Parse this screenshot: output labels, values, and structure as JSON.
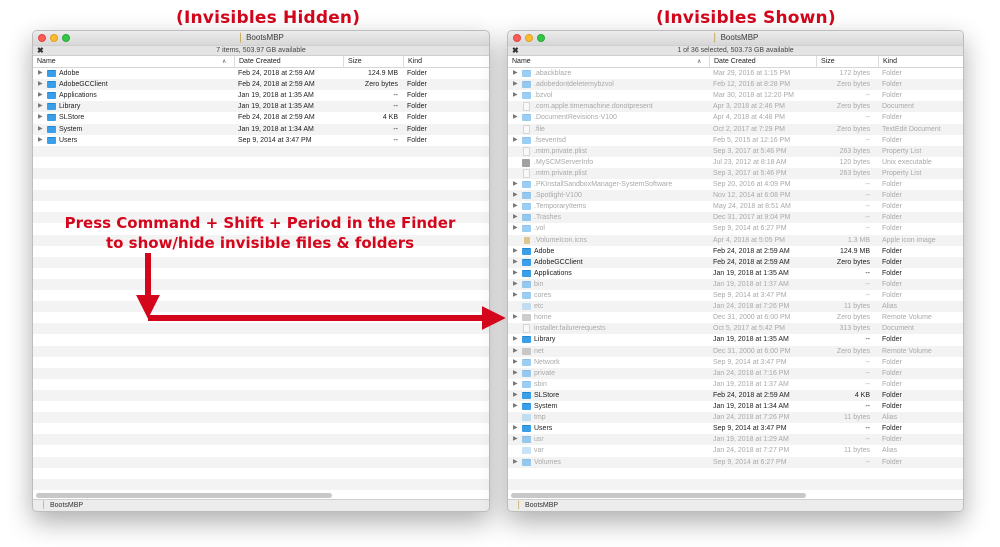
{
  "captions": {
    "left": "(Invisibles Hidden)",
    "right": "(Invisibles Shown)"
  },
  "instruction": {
    "line1": "Press Command + Shift + Period in the Finder",
    "line2": "to show/hide invisible files & folders"
  },
  "colors": {
    "annotation": "#d3061c",
    "folder": "#3a9ee8",
    "hidden_text": "#a9a9a9"
  },
  "columns": {
    "name": "Name",
    "date": "Date Created",
    "size": "Size",
    "kind": "Kind"
  },
  "left_window": {
    "title": "BootsMBP",
    "status": "7 items, 503.97 GB available",
    "path": "BootsMBP",
    "rows": [
      {
        "name": "Adobe",
        "date": "Feb 24, 2018 at 2:59 AM",
        "size": "124.9 MB",
        "kind": "Folder",
        "icon": "folder",
        "expandable": true
      },
      {
        "name": "AdobeGCClient",
        "date": "Feb 24, 2018 at 2:59 AM",
        "size": "Zero bytes",
        "kind": "Folder",
        "icon": "folder",
        "expandable": true
      },
      {
        "name": "Applications",
        "date": "Jan 19, 2018 at 1:35 AM",
        "size": "--",
        "kind": "Folder",
        "icon": "folder",
        "expandable": true
      },
      {
        "name": "Library",
        "date": "Jan 19, 2018 at 1:35 AM",
        "size": "--",
        "kind": "Folder",
        "icon": "folder",
        "expandable": true
      },
      {
        "name": "SLStore",
        "date": "Feb 24, 2018 at 2:59 AM",
        "size": "4 KB",
        "kind": "Folder",
        "icon": "folder",
        "expandable": true
      },
      {
        "name": "System",
        "date": "Jan 19, 2018 at 1:34 AM",
        "size": "--",
        "kind": "Folder",
        "icon": "folder",
        "expandable": true
      },
      {
        "name": "Users",
        "date": "Sep 9, 2014 at 3:47 PM",
        "size": "--",
        "kind": "Folder",
        "icon": "folder",
        "expandable": true
      }
    ]
  },
  "right_window": {
    "title": "BootsMBP",
    "status": "1 of 36 selected, 503.73 GB available",
    "path": "BootsMBP",
    "rows": [
      {
        "name": ".abackblaze",
        "date": "Mar 29, 2016 at 1:15 PM",
        "size": "172 bytes",
        "kind": "Folder",
        "icon": "folder",
        "expandable": true,
        "hidden": true
      },
      {
        "name": ".adobedontdeletemybzvol",
        "date": "Feb 12, 2016 at 8:28 PM",
        "size": "Zero bytes",
        "kind": "Folder",
        "icon": "folder",
        "expandable": true,
        "hidden": true
      },
      {
        "name": ".bzvol",
        "date": "Mar 30, 2018 at 12:20 PM",
        "size": "--",
        "kind": "Folder",
        "icon": "folder",
        "expandable": true,
        "hidden": true
      },
      {
        "name": ".com.apple.timemachine.donotpresent",
        "date": "Apr 3, 2018 at 2:46 PM",
        "size": "Zero bytes",
        "kind": "Document",
        "icon": "doc",
        "expandable": false,
        "hidden": true
      },
      {
        "name": ".DocumentRevisions-V100",
        "date": "Apr 4, 2018 at 4:48 PM",
        "size": "--",
        "kind": "Folder",
        "icon": "folder",
        "expandable": true,
        "hidden": true
      },
      {
        "name": ".file",
        "date": "Oct 2, 2017 at 7:29 PM",
        "size": "Zero bytes",
        "kind": "TextEdit Document",
        "icon": "doc",
        "expandable": false,
        "hidden": true
      },
      {
        "name": ".fseventsd",
        "date": "Feb 5, 2015 at 12:16 PM",
        "size": "--",
        "kind": "Folder",
        "icon": "folder",
        "expandable": true,
        "hidden": true
      },
      {
        "name": ".mtm.private.plist",
        "date": "Sep 3, 2017 at 5:46 PM",
        "size": "263 bytes",
        "kind": "Property List",
        "icon": "doc",
        "expandable": false,
        "hidden": true
      },
      {
        "name": ".MySCMServerInfo",
        "date": "Jul 23, 2012 at 8:18 AM",
        "size": "120 bytes",
        "kind": "Unix executable",
        "icon": "exec",
        "expandable": false,
        "hidden": true
      },
      {
        "name": ".mtm.private.plist",
        "date": "Sep 3, 2017 at 5:46 PM",
        "size": "263 bytes",
        "kind": "Property List",
        "icon": "doc",
        "expandable": false,
        "hidden": true
      },
      {
        "name": ".PKInstallSandboxManager-SystemSoftware",
        "date": "Sep 20, 2016 at 4:09 PM",
        "size": "--",
        "kind": "Folder",
        "icon": "folder",
        "expandable": true,
        "hidden": true
      },
      {
        "name": ".Spotlight-V100",
        "date": "Nov 12, 2014 at 6:08 PM",
        "size": "--",
        "kind": "Folder",
        "icon": "folder",
        "expandable": true,
        "hidden": true
      },
      {
        "name": ".TemporaryItems",
        "date": "May 24, 2018 at 8:51 AM",
        "size": "--",
        "kind": "Folder",
        "icon": "folder",
        "expandable": true,
        "hidden": true
      },
      {
        "name": ".Trashes",
        "date": "Dec 31, 2017 at 9:04 PM",
        "size": "--",
        "kind": "Folder",
        "icon": "folder",
        "expandable": true,
        "hidden": true
      },
      {
        "name": ".vol",
        "date": "Sep 9, 2014 at 6:27 PM",
        "size": "--",
        "kind": "Folder",
        "icon": "folder",
        "expandable": true,
        "hidden": true
      },
      {
        "name": ".VolumeIcon.icns",
        "date": "Apr 4, 2018 at 5:05 PM",
        "size": "1.3 MB",
        "kind": "Apple icon image",
        "icon": "icns",
        "expandable": false,
        "hidden": true
      },
      {
        "name": "Adobe",
        "date": "Feb 24, 2018 at 2:59 AM",
        "size": "124.9 MB",
        "kind": "Folder",
        "icon": "folder",
        "expandable": true,
        "hidden": false
      },
      {
        "name": "AdobeGCClient",
        "date": "Feb 24, 2018 at 2:59 AM",
        "size": "Zero bytes",
        "kind": "Folder",
        "icon": "folder",
        "expandable": true,
        "hidden": false
      },
      {
        "name": "Applications",
        "date": "Jan 19, 2018 at 1:35 AM",
        "size": "--",
        "kind": "Folder",
        "icon": "folder",
        "expandable": true,
        "hidden": false
      },
      {
        "name": "bin",
        "date": "Jan 19, 2018 at 1:37 AM",
        "size": "--",
        "kind": "Folder",
        "icon": "folder",
        "expandable": true,
        "hidden": true
      },
      {
        "name": "cores",
        "date": "Sep 9, 2014 at 3:47 PM",
        "size": "--",
        "kind": "Folder",
        "icon": "folder",
        "expandable": true,
        "hidden": true
      },
      {
        "name": "etc",
        "date": "Jan 24, 2018 at 7:26 PM",
        "size": "11 bytes",
        "kind": "Alias",
        "icon": "alias",
        "expandable": false,
        "hidden": true
      },
      {
        "name": "home",
        "date": "Dec 31, 2000 at 6:00 PM",
        "size": "Zero bytes",
        "kind": "Remote Volume",
        "icon": "volume",
        "expandable": true,
        "hidden": true
      },
      {
        "name": "installer.failurerequests",
        "date": "Oct 5, 2017 at 5:42 PM",
        "size": "313 bytes",
        "kind": "Document",
        "icon": "doc",
        "expandable": false,
        "hidden": true
      },
      {
        "name": "Library",
        "date": "Jan 19, 2018 at 1:35 AM",
        "size": "--",
        "kind": "Folder",
        "icon": "folder",
        "expandable": true,
        "hidden": false
      },
      {
        "name": "net",
        "date": "Dec 31, 2000 at 6:00 PM",
        "size": "Zero bytes",
        "kind": "Remote Volume",
        "icon": "volume",
        "expandable": true,
        "hidden": true
      },
      {
        "name": "Network",
        "date": "Sep 9, 2014 at 3:47 PM",
        "size": "--",
        "kind": "Folder",
        "icon": "folder",
        "expandable": true,
        "hidden": true
      },
      {
        "name": "private",
        "date": "Jan 24, 2018 at 7:16 PM",
        "size": "--",
        "kind": "Folder",
        "icon": "folder",
        "expandable": true,
        "hidden": true
      },
      {
        "name": "sbin",
        "date": "Jan 19, 2018 at 1:37 AM",
        "size": "--",
        "kind": "Folder",
        "icon": "folder",
        "expandable": true,
        "hidden": true
      },
      {
        "name": "SLStore",
        "date": "Feb 24, 2018 at 2:59 AM",
        "size": "4 KB",
        "kind": "Folder",
        "icon": "folder",
        "expandable": true,
        "hidden": false
      },
      {
        "name": "System",
        "date": "Jan 19, 2018 at 1:34 AM",
        "size": "--",
        "kind": "Folder",
        "icon": "folder",
        "expandable": true,
        "hidden": false
      },
      {
        "name": "tmp",
        "date": "Jan 24, 2018 at 7:26 PM",
        "size": "11 bytes",
        "kind": "Alias",
        "icon": "alias",
        "expandable": false,
        "hidden": true
      },
      {
        "name": "Users",
        "date": "Sep 9, 2014 at 3:47 PM",
        "size": "--",
        "kind": "Folder",
        "icon": "folder",
        "expandable": true,
        "hidden": false
      },
      {
        "name": "usr",
        "date": "Jan 19, 2018 at 1:29 AM",
        "size": "--",
        "kind": "Folder",
        "icon": "folder",
        "expandable": true,
        "hidden": true
      },
      {
        "name": "var",
        "date": "Jan 24, 2018 at 7:27 PM",
        "size": "11 bytes",
        "kind": "Alias",
        "icon": "alias",
        "expandable": false,
        "hidden": true
      },
      {
        "name": "Volumes",
        "date": "Sep 9, 2014 at 6:27 PM",
        "size": "--",
        "kind": "Folder",
        "icon": "folder",
        "expandable": true,
        "hidden": true
      }
    ]
  }
}
